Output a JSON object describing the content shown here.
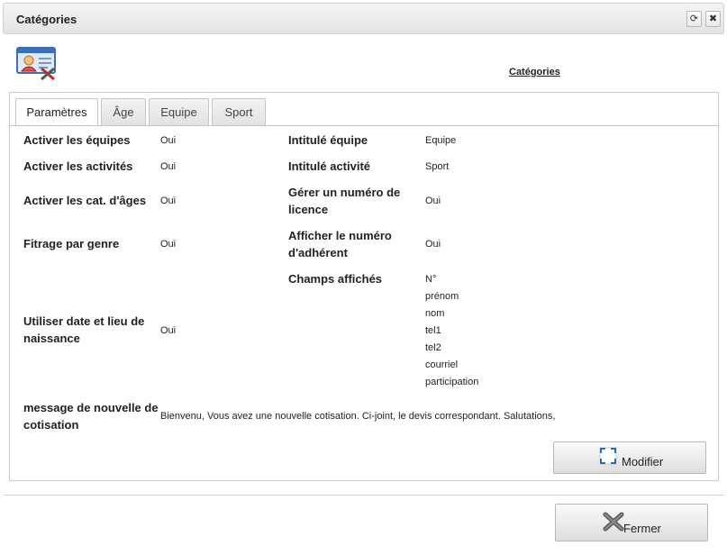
{
  "window": {
    "title": "Catégories",
    "refresh_icon": "refresh-icon",
    "close_icon": "close-icon"
  },
  "header": {
    "icon": "user-settings-icon",
    "link_label": "Catégories"
  },
  "tabs": [
    {
      "label": "Paramètres",
      "active": true
    },
    {
      "label": "Âge",
      "active": false
    },
    {
      "label": "Equipe",
      "active": false
    },
    {
      "label": "Sport",
      "active": false
    }
  ],
  "settings_left": [
    {
      "label": "Activer les équipes",
      "value": "Oui"
    },
    {
      "label": "Activer les activités",
      "value": "Oui"
    },
    {
      "label": "Activer les cat. d'âges",
      "value": "Oui"
    },
    {
      "label": "Fitrage par genre",
      "value": "Oui"
    },
    {
      "label": "Utiliser date et lieu de naissance",
      "value": "Oui"
    },
    {
      "label": "message de nouvelle de cotisation",
      "value": "Bienvenu, Vous avez une nouvelle cotisation. Ci-joint, le devis correspondant. Salutations,"
    }
  ],
  "settings_right": [
    {
      "label": "Intitulé équipe",
      "value": "Equipe"
    },
    {
      "label": "Intitulé activité",
      "value": "Sport"
    },
    {
      "label": "Gérer un numéro de licence",
      "value": "Oui"
    },
    {
      "label": "Afficher le numéro d'adhérent",
      "value": "Oui"
    },
    {
      "label": "Champs affichés",
      "value": ""
    }
  ],
  "displayed_fields": [
    "N°",
    "prénom",
    "nom",
    "tel1",
    "tel2",
    "courriel",
    "participation"
  ],
  "buttons": {
    "modify_label": "Modifier",
    "modify_icon": "fullscreen-icon",
    "close_label": "Fermer",
    "close_icon": "close-x-icon"
  }
}
